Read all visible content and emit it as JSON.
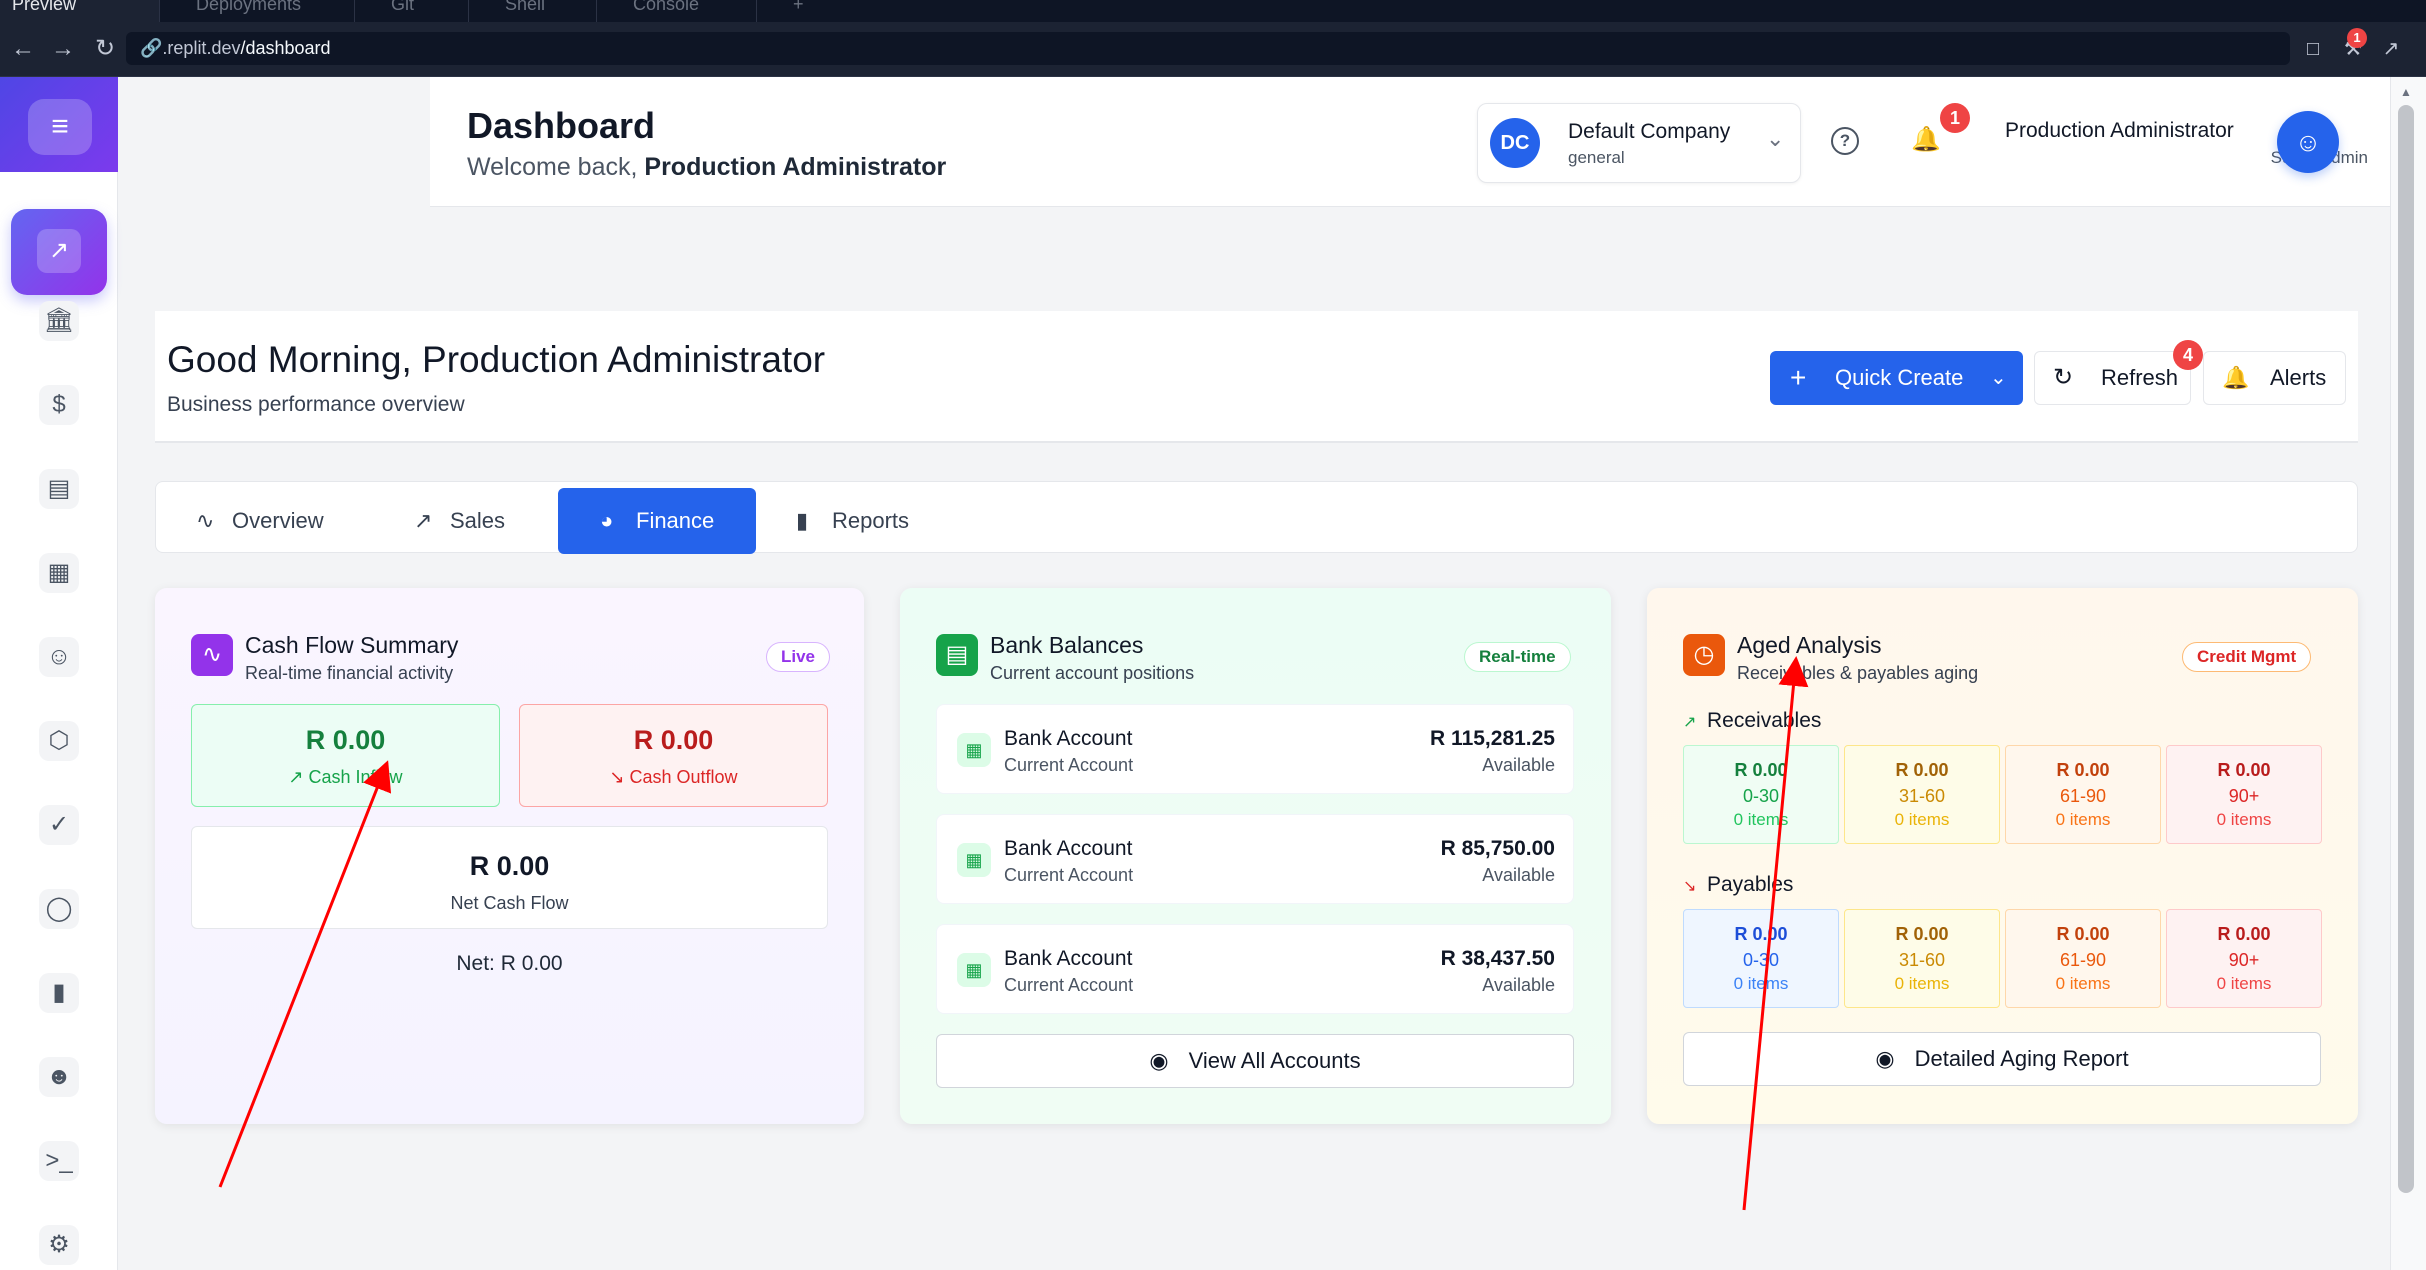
{
  "replit": {
    "tabs": [
      "Preview",
      "Deployments",
      "Git",
      "Shell",
      "Console",
      "+"
    ],
    "url_prefix": ".replit.dev",
    "url_path": "/dashboard",
    "badge_count": "1"
  },
  "sidebar": {
    "items": [
      "dashboard",
      "bank",
      "dollar",
      "invoice",
      "calculator",
      "users",
      "package",
      "document-check",
      "shield",
      "bar-chart",
      "team",
      "terminal",
      "settings"
    ]
  },
  "header": {
    "title": "Dashboard",
    "welcome_prefix": "Welcome back, ",
    "welcome_name": "Production Administrator",
    "company": {
      "initials": "DC",
      "name": "Default Company",
      "sub": "general"
    },
    "notifications": "1",
    "user": {
      "name": "Production Administrator",
      "role": "Super Admin"
    }
  },
  "greeting": {
    "title": "Good Morning, Production Administrator",
    "subtitle": "Business performance overview",
    "quick_create": "Quick Create",
    "refresh": "Refresh",
    "alerts": "Alerts",
    "alerts_count": "4"
  },
  "tabs": {
    "overview": "Overview",
    "sales": "Sales",
    "finance": "Finance",
    "reports": "Reports",
    "active": "Finance"
  },
  "cash_flow": {
    "title": "Cash Flow Summary",
    "subtitle": "Real-time financial activity",
    "tag": "Live",
    "inflow_amount": "R 0.00",
    "inflow_label": "Cash Inflow",
    "outflow_amount": "R 0.00",
    "outflow_label": "Cash Outflow",
    "net_amount": "R 0.00",
    "net_label": "Net Cash Flow",
    "net_line": "Net: R 0.00"
  },
  "bank": {
    "title": "Bank Balances",
    "subtitle": "Current account positions",
    "tag": "Real-time",
    "accounts": [
      {
        "name": "Bank Account",
        "type": "Current Account",
        "amount": "R 115,281.25",
        "status": "Available"
      },
      {
        "name": "Bank Account",
        "type": "Current Account",
        "amount": "R 85,750.00",
        "status": "Available"
      },
      {
        "name": "Bank Account",
        "type": "Current Account",
        "amount": "R 38,437.50",
        "status": "Available"
      }
    ],
    "view_all": "View All Accounts"
  },
  "aged": {
    "title": "Aged Analysis",
    "subtitle": "Receivables & payables aging",
    "tag": "Credit Mgmt",
    "receivables_label": "Receivables",
    "payables_label": "Payables",
    "receivables": [
      {
        "amount": "R 0.00",
        "range": "0-30",
        "count": "0 items"
      },
      {
        "amount": "R 0.00",
        "range": "31-60",
        "count": "0 items"
      },
      {
        "amount": "R 0.00",
        "range": "61-90",
        "count": "0 items"
      },
      {
        "amount": "R 0.00",
        "range": "90+",
        "count": "0 items"
      }
    ],
    "payables": [
      {
        "amount": "R 0.00",
        "range": "0-30",
        "count": "0 items"
      },
      {
        "amount": "R 0.00",
        "range": "31-60",
        "count": "0 items"
      },
      {
        "amount": "R 0.00",
        "range": "61-90",
        "count": "0 items"
      },
      {
        "amount": "R 0.00",
        "range": "90+",
        "count": "0 items"
      }
    ],
    "report_button": "Detailed Aging Report"
  },
  "colors": {
    "primary": "#2563eb",
    "sidebar_accent": "#7c3aed",
    "inflow": "#15803d",
    "outflow": "#b91c1c",
    "annotation": "#ff0000"
  }
}
